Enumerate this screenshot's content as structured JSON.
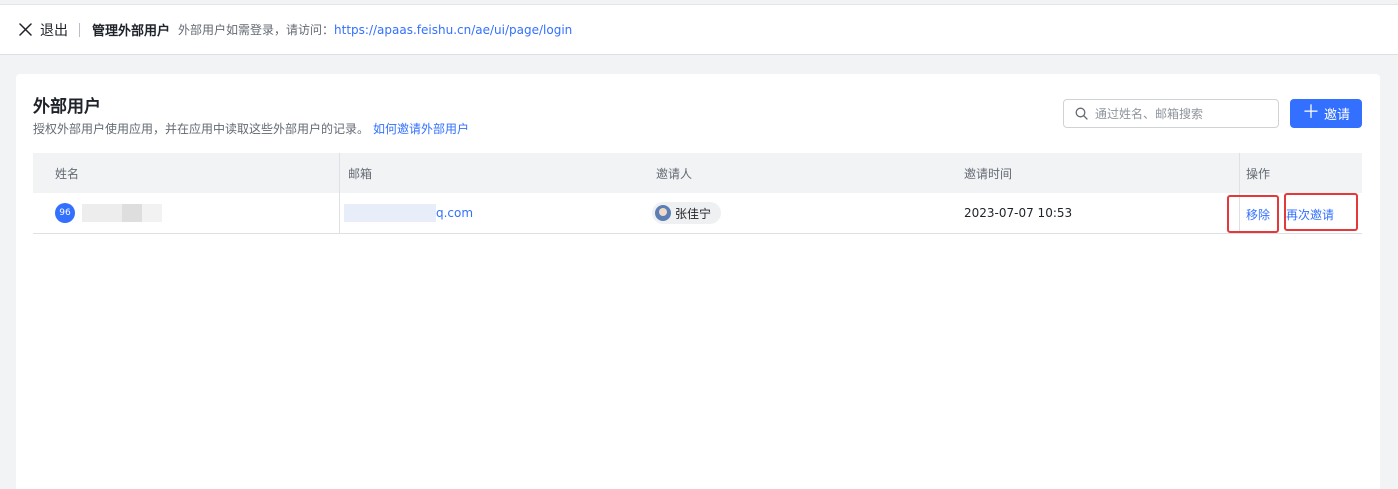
{
  "topbar": {
    "exit_label": "退出",
    "title": "管理外部用户",
    "note": "外部用户如需登录，请访问：",
    "login_url": "https://apaas.feishu.cn/ae/ui/page/login"
  },
  "page": {
    "title": "外部用户",
    "description": "授权外部用户使用应用，并在应用中读取这些外部用户的记录。",
    "help_link": "如何邀请外部用户"
  },
  "search": {
    "placeholder": "通过姓名、邮箱搜索"
  },
  "invite_button": {
    "label": "邀请",
    "icon": "plus-icon"
  },
  "table": {
    "columns": [
      "姓名",
      "邮箱",
      "邀请人",
      "邀请时间",
      "操作"
    ],
    "rows": [
      {
        "avatar_text": "96",
        "email_visible": "q.com",
        "inviter": "张佳宁",
        "invite_time": "2023-07-07 10:53",
        "actions": [
          "移除",
          "再次邀请"
        ]
      }
    ]
  },
  "colors": {
    "accent": "#3370ff",
    "highlight_box": "#e5383b",
    "background": "#f2f3f5"
  }
}
